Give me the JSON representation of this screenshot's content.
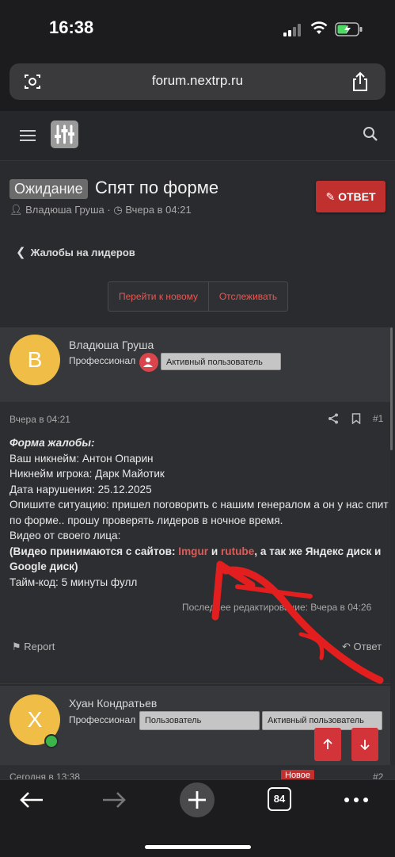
{
  "status": {
    "time": "16:38"
  },
  "browser": {
    "url": "forum.nextrp.ru",
    "tabs_count": "84"
  },
  "thread": {
    "prefix": "Ожидание",
    "title": "Спят по форме",
    "author": "Владюша Груша",
    "date": "Вчера в 04:21",
    "reply_label": "ОТВЕТ",
    "breadcrumb": "Жалобы на лидеров",
    "goto_new": "Перейти к новому",
    "watch": "Отслеживать"
  },
  "post1": {
    "avatar_letter": "B",
    "username": "Владюша Груша",
    "rank": "Профессионал",
    "badge": "Активный пользователь",
    "date": "Вчера в 04:21",
    "number": "#1",
    "form_title": "Форма жалобы:",
    "lines": [
      "Ваш никнейм: Антон Опарин",
      "Никнейм игрока: Дарк Майотик",
      "Дата нарушения: 25.12.2025",
      "Опишите ситуацию: пришел поговорить с нашим генералом а он у нас спит по форме.. прошу проверять лидеров в ночное время.",
      "Видео от своего лица:"
    ],
    "video_note_start": "(Видео принимаются с сайтов: ",
    "link1": "Imgur",
    "and_word": " и ",
    "link2": "rutube",
    "video_note_end": ", а так же Яндекс диск и Google диск)",
    "timecode": "Тайм-код: 5 минуты фулл",
    "edited": "Последнее редактирование: Вчера в 04:26",
    "report": "Report",
    "reply": "Ответ"
  },
  "post2": {
    "avatar_letter": "X",
    "username": "Хуан Кондратьев",
    "rank": "Профессионал",
    "badge1": "Пользователь",
    "badge2": "Активный пользователь",
    "date": "Сегодня в 13:38",
    "new_label": "Новое",
    "number": "#2"
  },
  "colors": {
    "accent": "#c0302f",
    "link": "#e05a56",
    "avatar1": "#f0be46"
  },
  "icons": [
    "camera-icon",
    "share-icon",
    "menu-icon",
    "search-icon",
    "pencil-icon",
    "back-chevron-icon",
    "bookmark-icon",
    "flag-icon",
    "reply-icon",
    "arrow-up-icon",
    "arrow-down-icon",
    "back-arrow-icon",
    "forward-arrow-icon",
    "plus-icon",
    "more-icon"
  ]
}
